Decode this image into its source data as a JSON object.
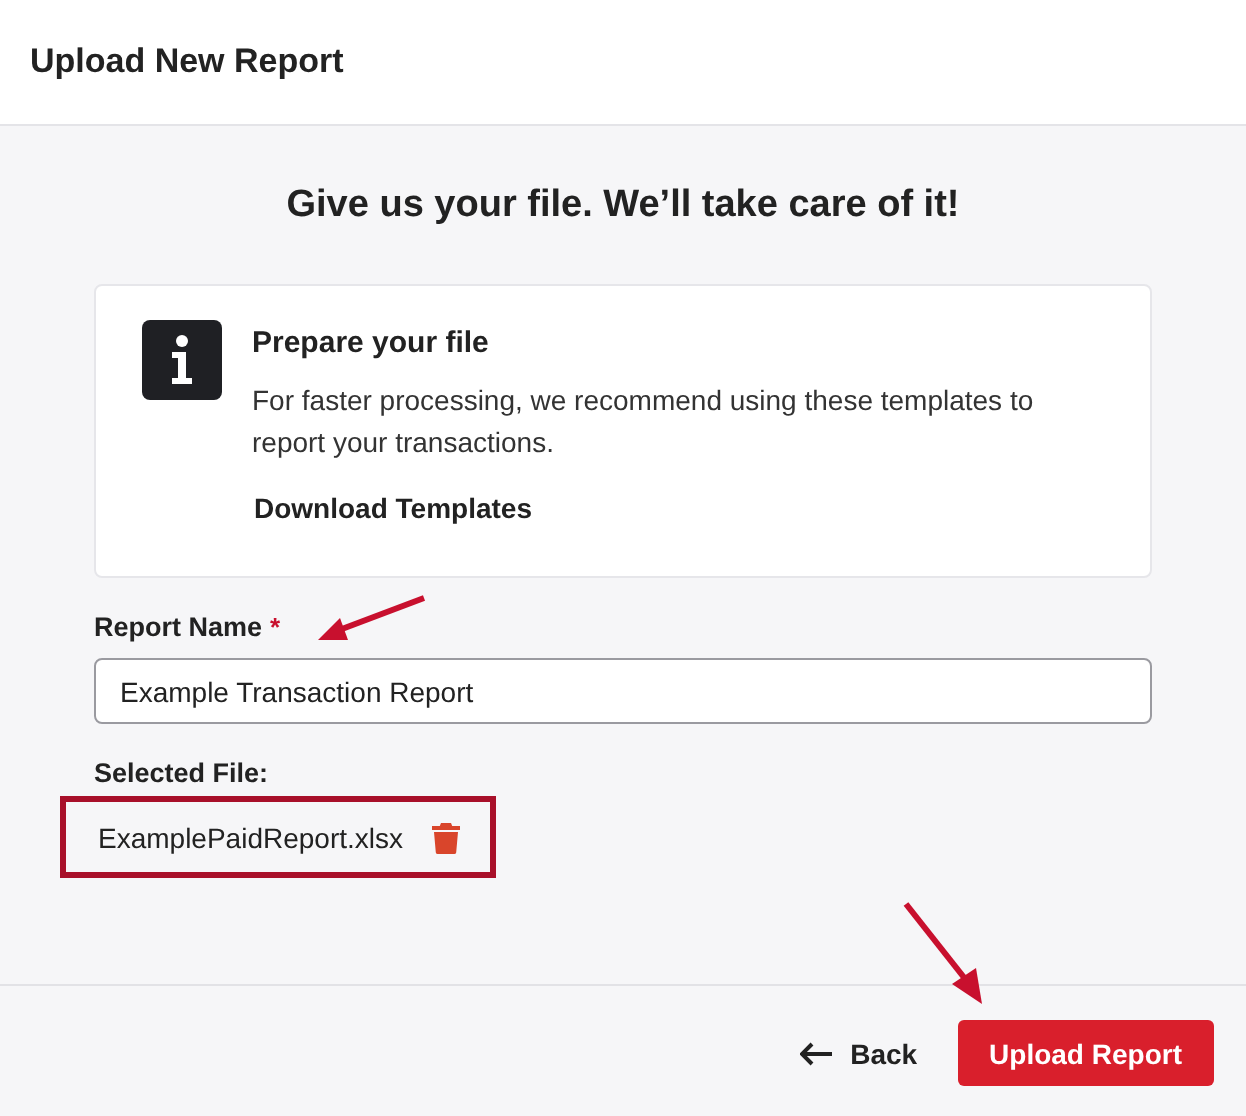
{
  "dialog": {
    "title": "Upload New Report"
  },
  "heading": "Give us your file. We’ll take care of it!",
  "info_card": {
    "title": "Prepare your file",
    "text": "For faster processing, we recommend using these templates to report your transactions.",
    "link": "Download Templates"
  },
  "report_name": {
    "label": "Report Name",
    "required": true,
    "required_mark": "*",
    "value": "Example Transaction Report"
  },
  "selected_file": {
    "label": "Selected File:",
    "name": "ExamplePaidReport.xlsx",
    "highlighted": true
  },
  "buttons": [
    {
      "kind": "back",
      "label": "Back"
    },
    {
      "kind": "primary",
      "label": "Upload Report"
    }
  ]
}
